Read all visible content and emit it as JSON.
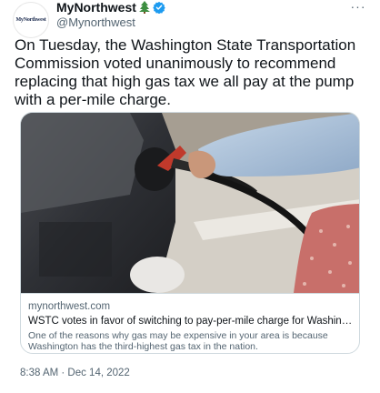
{
  "account": {
    "avatar_text": "MyNorthwest",
    "display_name": "MyNorthwest",
    "handle": "@Mynorthwest",
    "name_emoji_icon": "evergreen-tree-icon",
    "verified_icon": "verified-badge-icon"
  },
  "tweet": {
    "text": "On Tuesday, the Washington State Transportation Commission voted unanimously to recommend replacing that high gas tax we all pay at the pump with a per-mile charge.",
    "timestamp": "8:38 AM · Dec 14, 2022",
    "more_label": "···"
  },
  "card": {
    "domain": "mynorthwest.com",
    "title": "WSTC votes in favor of switching to pay-per-mile charge for Washington driver...",
    "description": "One of the reasons why gas may be expensive in your area is because Washington has the third-highest gas tax in the nation."
  },
  "colors": {
    "text": "#0f1419",
    "secondary": "#536471",
    "verified": "#1d9bf0",
    "border": "#cfd9de"
  }
}
